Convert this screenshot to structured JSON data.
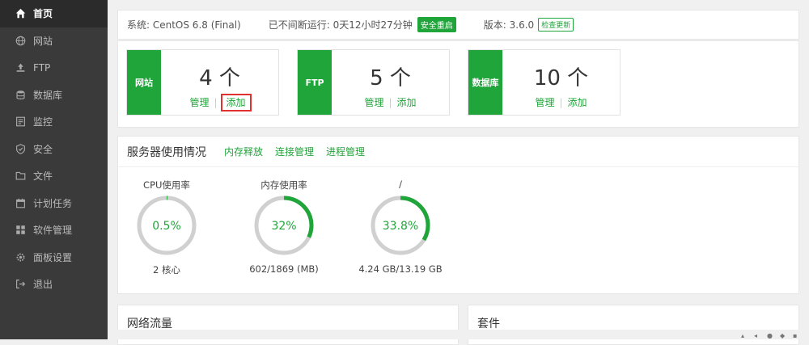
{
  "sidebar": {
    "items": [
      {
        "label": "首页",
        "icon": "home-icon",
        "active": true
      },
      {
        "label": "网站",
        "icon": "globe-icon"
      },
      {
        "label": "FTP",
        "icon": "upload-icon"
      },
      {
        "label": "数据库",
        "icon": "database-icon"
      },
      {
        "label": "监控",
        "icon": "monitor-icon"
      },
      {
        "label": "安全",
        "icon": "shield-icon"
      },
      {
        "label": "文件",
        "icon": "folder-icon"
      },
      {
        "label": "计划任务",
        "icon": "calendar-icon"
      },
      {
        "label": "软件管理",
        "icon": "apps-icon"
      },
      {
        "label": "面板设置",
        "icon": "gear-icon"
      },
      {
        "label": "退出",
        "icon": "logout-icon"
      }
    ]
  },
  "sysinfo": {
    "system": "系统: CentOS 6.8 (Final)",
    "uptime": "已不间断运行: 0天12小时27分钟",
    "safe_restart": "安全重启",
    "version": "版本: 3.6.0",
    "check_update": "检查更新"
  },
  "stats": [
    {
      "label": "网站",
      "count": "4 个",
      "manage": "管理",
      "add": "添加",
      "sep": "|"
    },
    {
      "label": "FTP",
      "count": "5 个",
      "manage": "管理",
      "add": "添加",
      "sep": "|"
    },
    {
      "label": "数据库",
      "count": "10 个",
      "manage": "管理",
      "add": "添加",
      "sep": "|"
    }
  ],
  "usage": {
    "title": "服务器使用情况",
    "links": [
      "内存释放",
      "连接管理",
      "进程管理"
    ],
    "gauges": [
      {
        "title": "CPU使用率",
        "value": "0.5%",
        "percent": 0.5,
        "sub": "2 核心"
      },
      {
        "title": "内存使用率",
        "value": "32%",
        "percent": 32,
        "sub": "602/1869 (MB)"
      },
      {
        "title": "/",
        "value": "33.8%",
        "percent": 33.8,
        "sub": "4.24 GB/13.19 GB"
      }
    ]
  },
  "bottom": {
    "network": "网络流量",
    "plugins": "套件"
  },
  "colors": {
    "accent": "#20a53a",
    "sidebar": "#3a3a3a",
    "highlight": "#e03030"
  }
}
